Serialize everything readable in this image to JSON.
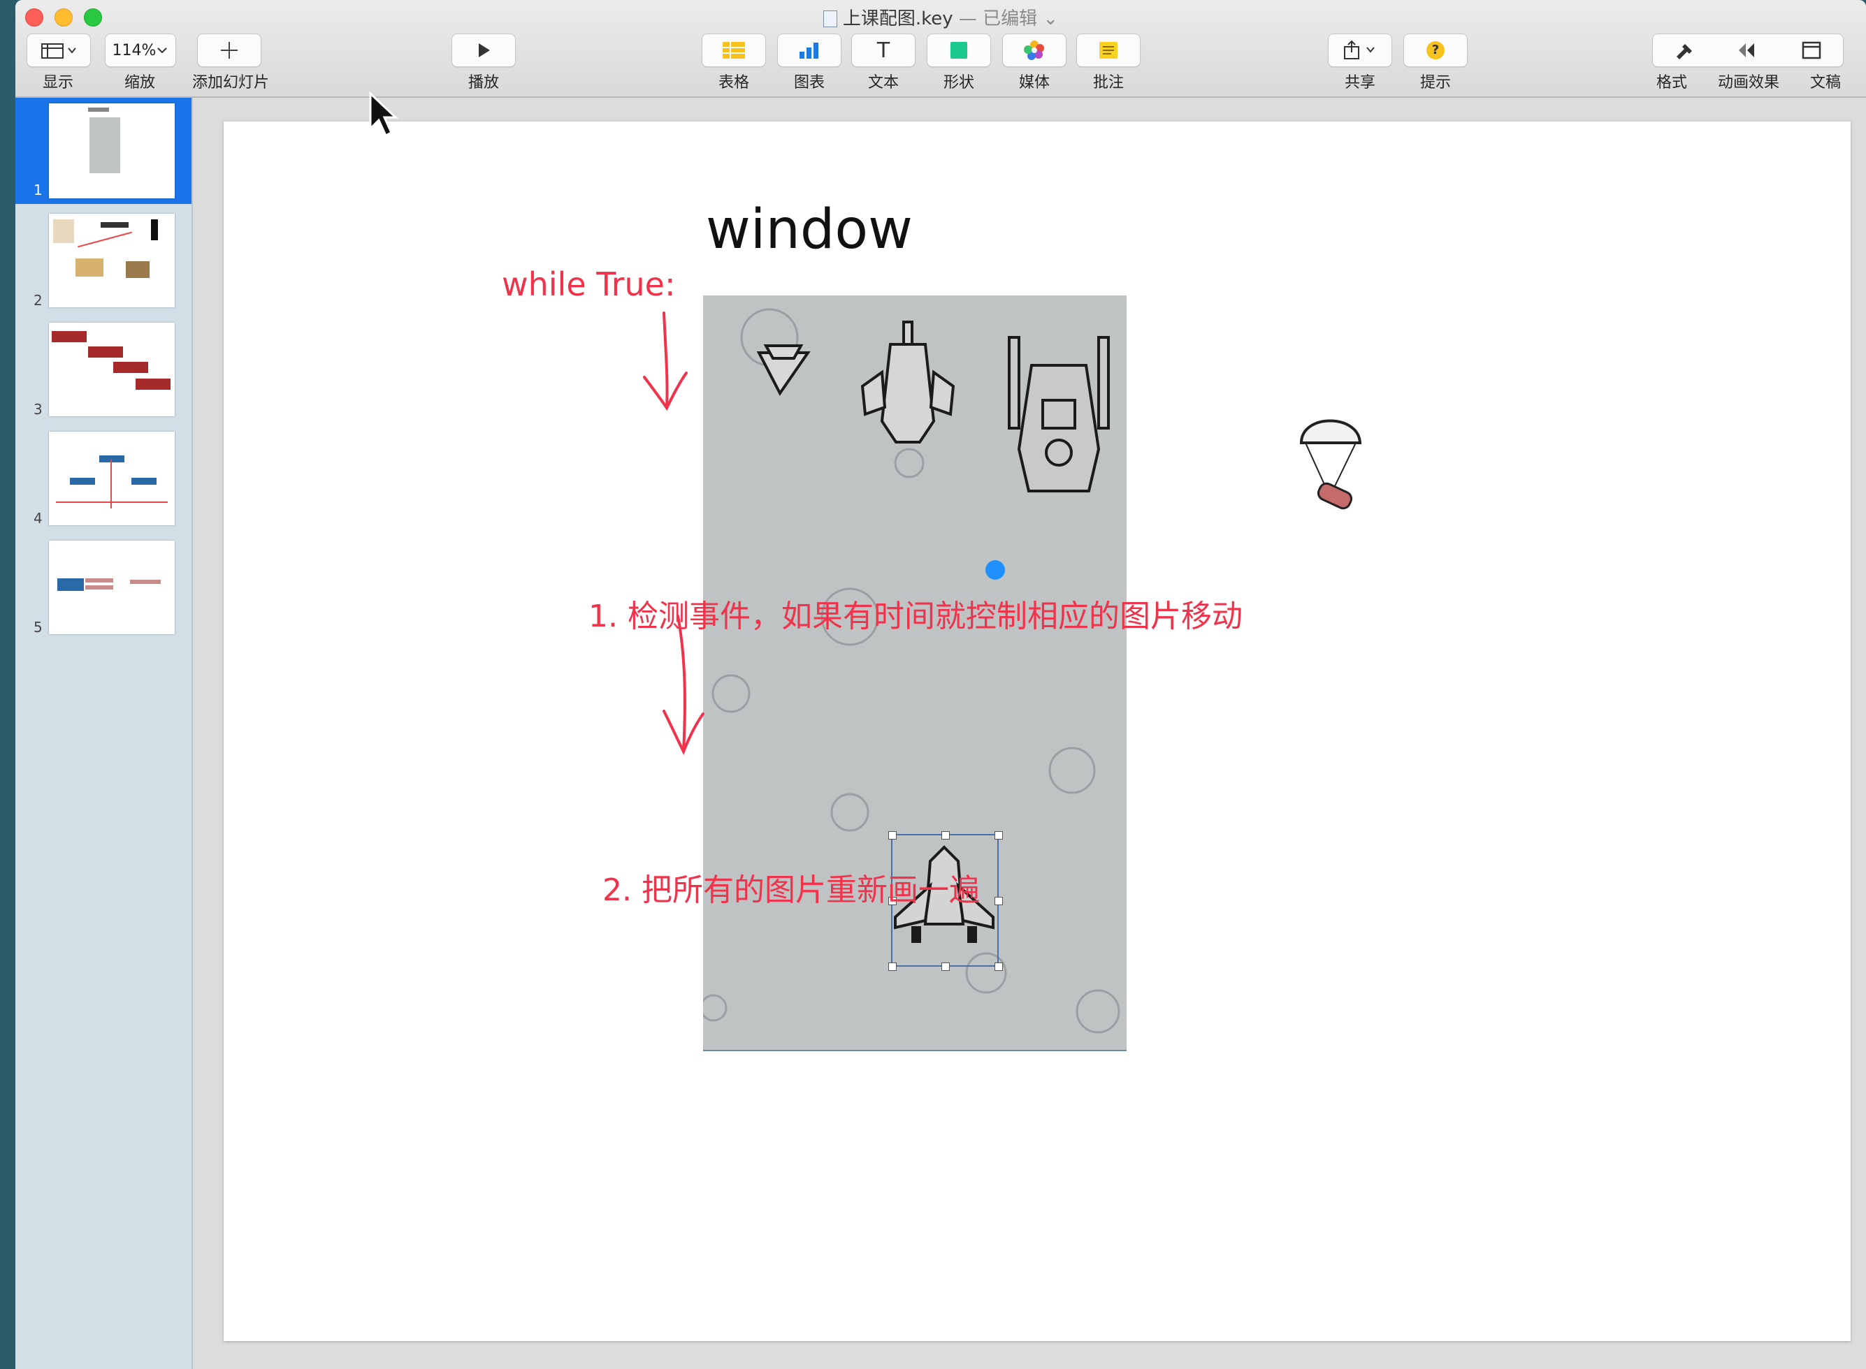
{
  "window": {
    "title": "上课配图.key",
    "title_suffix": "— 已编辑",
    "title_chevron": "⌄"
  },
  "toolbar": {
    "view_label": "显示",
    "zoom_value": "114%",
    "zoom_label": "缩放",
    "add_slide_label": "添加幻灯片",
    "play_label": "播放",
    "table_label": "表格",
    "chart_label": "图表",
    "text_label": "文本",
    "text_glyph": "T",
    "shape_label": "形状",
    "media_label": "媒体",
    "comment_label": "批注",
    "share_label": "共享",
    "tips_label": "提示",
    "tips_glyph": "?",
    "format_label": "格式",
    "animate_label": "动画效果",
    "document_label": "文稿"
  },
  "sidebar": {
    "slides": [
      {
        "number": "1",
        "selected": true
      },
      {
        "number": "2",
        "selected": false
      },
      {
        "number": "3",
        "selected": false
      },
      {
        "number": "4",
        "selected": false
      },
      {
        "number": "5",
        "selected": false
      }
    ]
  },
  "slide": {
    "window_title": "window",
    "loop_label": "while True:",
    "step1": "1. 检测事件，如果有时间就控制相应的图片移动",
    "step2": "2. 把所有的图片重新画一遍"
  },
  "colors": {
    "accent": "#1a73e8",
    "annotation_red": "#f0334b",
    "game_bg": "#bfc3c4",
    "close": "#ff5f57",
    "minimize": "#febc2e",
    "zoom": "#28c840"
  }
}
